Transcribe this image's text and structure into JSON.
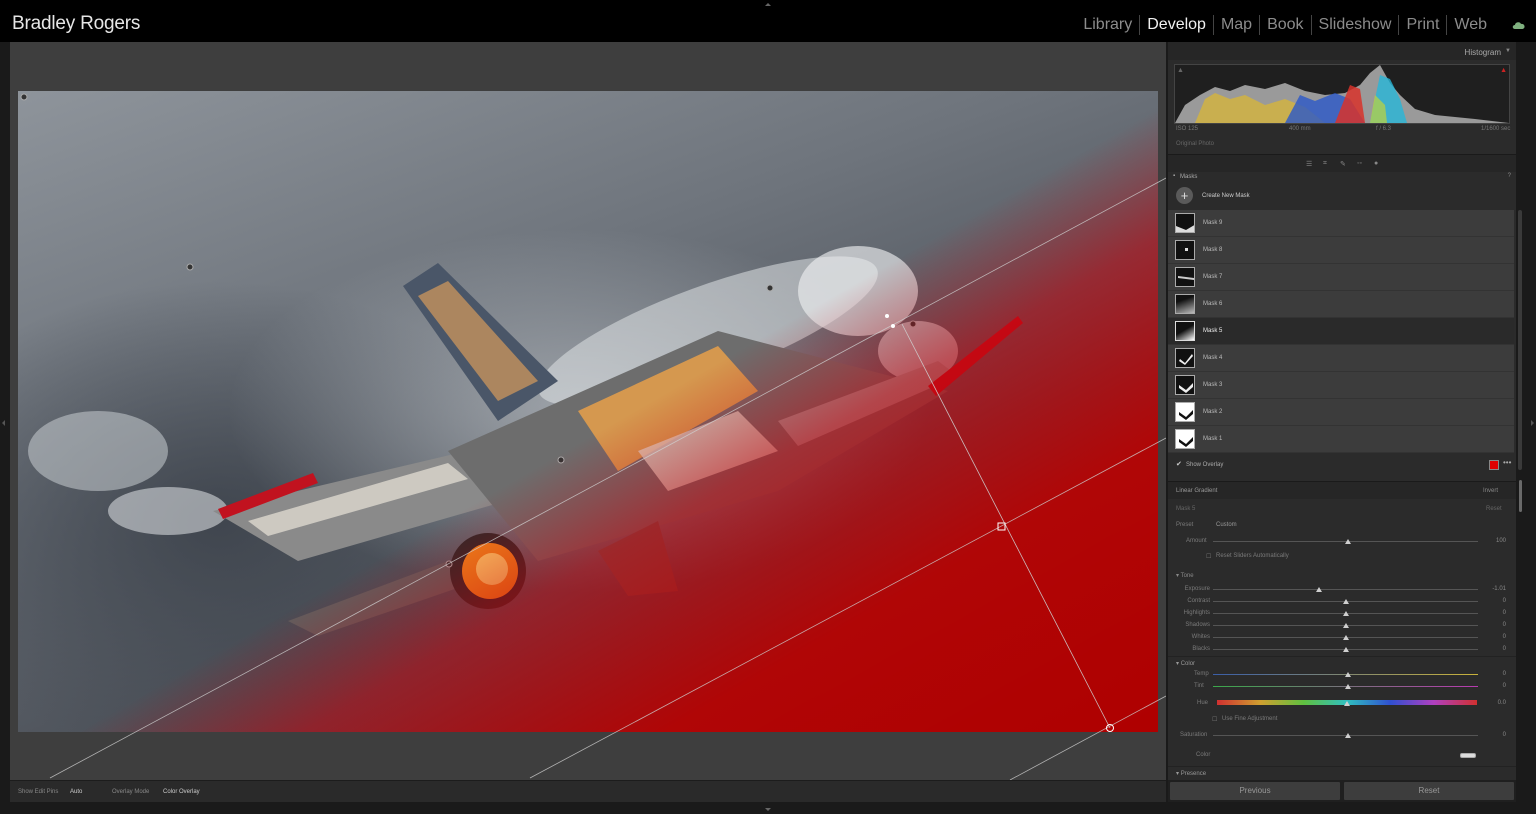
{
  "app": {
    "identity_plate": "Bradley Rogers",
    "modules": [
      "Library",
      "Develop",
      "Map",
      "Book",
      "Slideshow",
      "Print",
      "Web"
    ],
    "active_module": "Develop"
  },
  "histogram": {
    "title": "Histogram",
    "iso": "ISO 125",
    "focal": "400 mm",
    "aperture": "f / 6.3",
    "shutter": "1/1600 sec",
    "original_photo": "Original Photo"
  },
  "masks": {
    "title": "Masks",
    "create_label": "Create New Mask",
    "items": [
      {
        "name": "Mask 9"
      },
      {
        "name": "Mask 8"
      },
      {
        "name": "Mask 7"
      },
      {
        "name": "Mask 6"
      },
      {
        "name": "Mask 5"
      },
      {
        "name": "Mask 4"
      },
      {
        "name": "Mask 3"
      },
      {
        "name": "Mask 2"
      },
      {
        "name": "Mask 1"
      }
    ],
    "selected": "Mask 5",
    "show_overlay_label": "Show Overlay",
    "overlay_color": "#e00000"
  },
  "linear_gradient": {
    "title": "Linear Gradient",
    "invert_label": "Invert",
    "mask_name": "Mask 5",
    "reset_label": "Reset",
    "preset_label": "Preset",
    "preset_value": "Custom",
    "amount_label": "Amount",
    "amount_value": "100",
    "amount_fraction": 1.0,
    "reset_sliders_label": "Reset Sliders Automatically"
  },
  "tone": {
    "title": "Tone",
    "sliders": [
      {
        "label": "Exposure",
        "value": "-1.01",
        "pos": 0.4
      },
      {
        "label": "Contrast",
        "value": "0",
        "pos": 0.5
      },
      {
        "label": "Highlights",
        "value": "0",
        "pos": 0.5
      },
      {
        "label": "Shadows",
        "value": "0",
        "pos": 0.5
      },
      {
        "label": "Whites",
        "value": "0",
        "pos": 0.5
      },
      {
        "label": "Blacks",
        "value": "0",
        "pos": 0.5
      }
    ]
  },
  "color": {
    "title": "Color",
    "temp_label": "Temp",
    "temp_value": "0",
    "tint_label": "Tint",
    "tint_value": "0",
    "hue_label": "Hue",
    "hue_value": "0.0",
    "fine_label": "Use Fine Adjustment",
    "saturation_label": "Saturation",
    "saturation_value": "0",
    "color_label": "Color"
  },
  "presence": {
    "title": "Presence"
  },
  "toolbar": {
    "edit_pins_label": "Show Edit Pins",
    "edit_pins_value": "Auto",
    "overlay_mode_label": "Overlay Mode",
    "overlay_mode_value": "Color Overlay"
  },
  "footer": {
    "previous_label": "Previous",
    "reset_label": "Reset"
  }
}
